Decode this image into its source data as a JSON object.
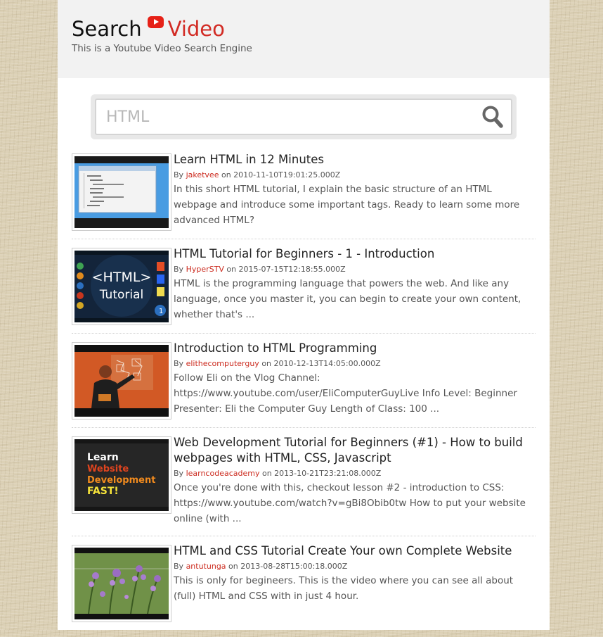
{
  "header": {
    "title_search": "Search",
    "title_video": "Video",
    "subtitle": "This is a Youtube Video Search Engine"
  },
  "search": {
    "value": "HTML"
  },
  "results": [
    {
      "title": "Learn HTML in 12 Minutes",
      "by": "By",
      "author": "jaketvee",
      "on": "on",
      "date": "2010-11-10T19:01:25.000Z",
      "description": "In this short HTML tutorial, I explain the basic structure of an HTML webpage and introduce some important tags. Ready to learn some more advanced HTML?"
    },
    {
      "title": "HTML Tutorial for Beginners - 1 - Introduction",
      "by": "By",
      "author": "HyperSTV",
      "on": "on",
      "date": "2015-07-15T12:18:55.000Z",
      "description": "HTML is the programming language that powers the web. And like any language, once you master it, you can begin to create your own content, whether that's ...",
      "thumb_text_1": "<HTML>",
      "thumb_text_2": "Tutorial"
    },
    {
      "title": "Introduction to HTML Programming",
      "by": "By",
      "author": "elithecomputerguy",
      "on": "on",
      "date": "2010-12-13T14:05:00.000Z",
      "description": "Follow Eli on the Vlog Channel: https://www.youtube.com/user/EliComputerGuyLive Info Level: Beginner Presenter: Eli the Computer Guy Length of Class: 100 ..."
    },
    {
      "title": "Web Development Tutorial for Beginners (#1) - How to build webpages with HTML, CSS, Javascript",
      "by": "By",
      "author": "learncodeacademy",
      "on": "on",
      "date": "2013-10-21T23:21:08.000Z",
      "description": "Once you're done with this, checkout lesson #2 - introduction to CSS: https://www.youtube.com/watch?v=gBi8Obib0tw How to put your website online (with ...",
      "thumb_text_1": "Learn",
      "thumb_text_2": "Website",
      "thumb_text_3": "Development",
      "thumb_text_4": "FAST!"
    },
    {
      "title": "HTML and CSS Tutorial Create Your own Complete Website",
      "by": "By",
      "author": "antutunga",
      "on": "on",
      "date": "2013-08-28T15:00:18.000Z",
      "description": "This is only for begineers. This is the video where you can see all about (full) HTML and CSS with in just 4 hour."
    }
  ],
  "colors": {
    "accent_red": "#d22b24",
    "author_red": "#cc2b1f",
    "youtube_red": "#e62117",
    "page_background": "#dcd1b6"
  },
  "icons": [
    "youtube-logo-icon",
    "search-icon"
  ]
}
